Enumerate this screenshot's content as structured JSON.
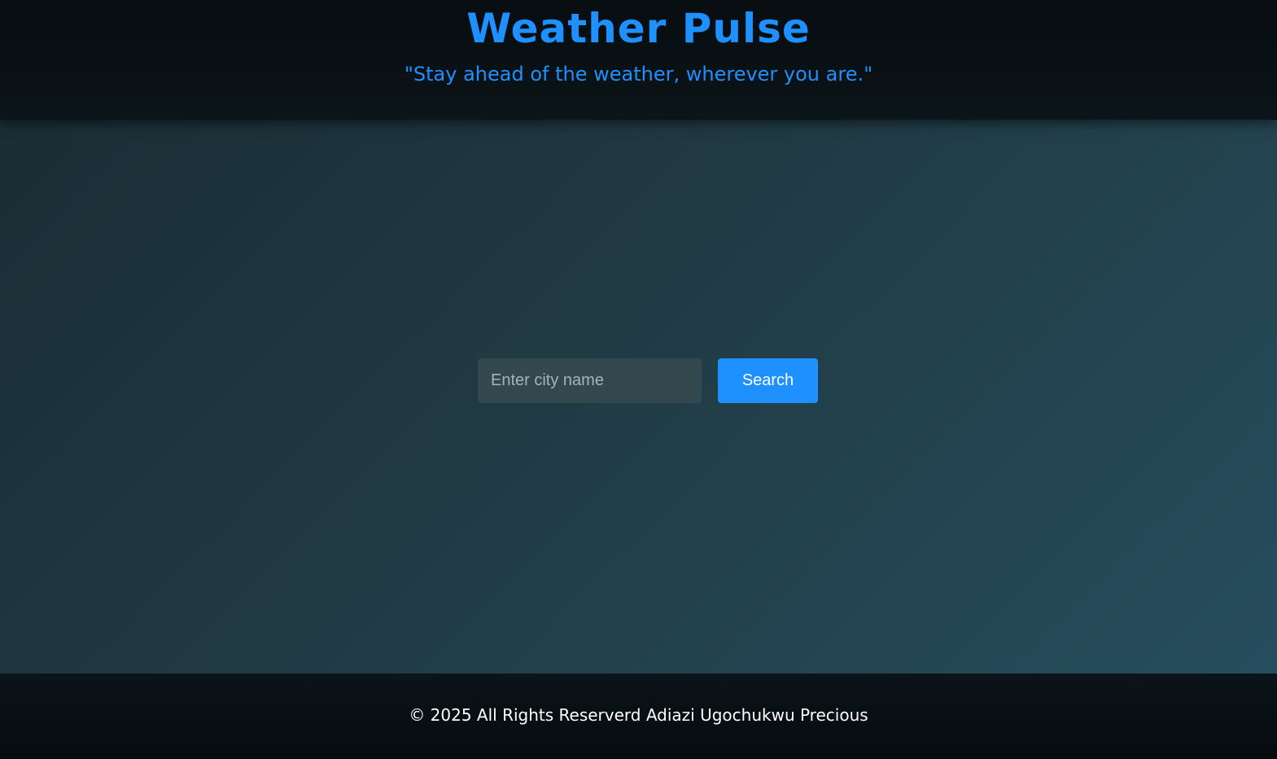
{
  "header": {
    "title": "Weather Pulse",
    "tagline": "\"Stay ahead of the weather, wherever you are.\""
  },
  "search": {
    "placeholder": "Enter city name",
    "value": "",
    "button_label": "Search"
  },
  "footer": {
    "copyright": "© 2025 All Rights Reserverd Adiazi Ugochukwu Precious"
  },
  "colors": {
    "accent": "#1e90ff",
    "header_bg": "#0a1114",
    "main_bg_start": "#1a2d35",
    "main_bg_end": "#264e5e",
    "input_bg": "#33474f",
    "footer_text": "#ffffff"
  }
}
